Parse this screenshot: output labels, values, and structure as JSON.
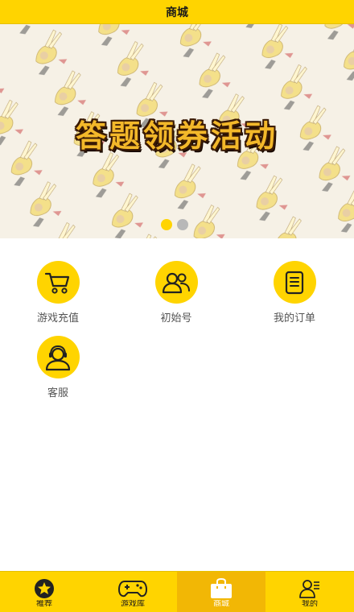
{
  "header": {
    "title": "商城"
  },
  "banner": {
    "title": "答题领券活动",
    "slides_total": 2,
    "active_slide": 1
  },
  "menu": [
    {
      "label": "游戏充值",
      "icon": "cart-icon"
    },
    {
      "label": "初始号",
      "icon": "users-icon"
    },
    {
      "label": "我的订单",
      "icon": "order-list-icon"
    },
    {
      "label": "客服",
      "icon": "customer-service-icon"
    }
  ],
  "tabbar": {
    "active": "商城",
    "tabs": [
      {
        "label": "推荐",
        "icon": "star-icon"
      },
      {
        "label": "游戏库",
        "icon": "gamepad-icon"
      },
      {
        "label": "商城",
        "icon": "shopping-bag-icon"
      },
      {
        "label": "我的",
        "icon": "profile-icon"
      }
    ]
  },
  "colors": {
    "brand_yellow": "#FFD400",
    "active_tab": "#F2B705",
    "label_gray": "#555555"
  }
}
